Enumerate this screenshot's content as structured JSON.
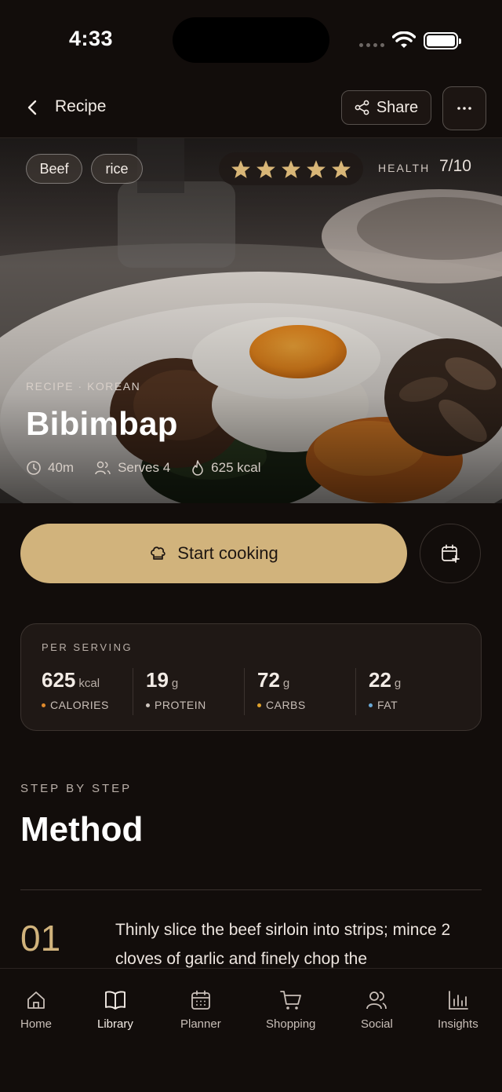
{
  "status_bar": {
    "time": "4:33"
  },
  "header": {
    "title": "Recipe",
    "share_label": "Share",
    "more_label": "···"
  },
  "hero": {
    "tags": [
      "Beef",
      "rice"
    ],
    "rating_stars": 5,
    "health_label": "HEALTH",
    "health_value": "7/10",
    "kicker": "RECIPE · KOREAN",
    "title": "Bibimbap",
    "time": "40m",
    "serves": "Serves 4",
    "calories": "625 kcal"
  },
  "actions": {
    "start_cooking": "Start cooking"
  },
  "nutrition": {
    "heading": "PER SERVING",
    "items": [
      {
        "value": "625",
        "unit": "kcal",
        "label": "CALORIES",
        "color": "#e08a2c"
      },
      {
        "value": "19",
        "unit": "g",
        "label": "PROTEIN",
        "color": "#cfc6bf"
      },
      {
        "value": "72",
        "unit": "g",
        "label": "CARBS",
        "color": "#e0a22c"
      },
      {
        "value": "22",
        "unit": "g",
        "label": "FAT",
        "color": "#6aa9d6"
      }
    ]
  },
  "method": {
    "kicker": "STEP BY STEP",
    "title": "Method",
    "steps": [
      {
        "number": "01",
        "text": "Thinly slice the beef sirloin into strips; mince 2 cloves of garlic and finely chop the"
      }
    ]
  },
  "tabbar": {
    "items": [
      {
        "label": "Home",
        "icon": "home-icon"
      },
      {
        "label": "Library",
        "icon": "book-icon"
      },
      {
        "label": "Planner",
        "icon": "calendar-icon"
      },
      {
        "label": "Shopping",
        "icon": "cart-icon"
      },
      {
        "label": "Social",
        "icon": "users-icon"
      },
      {
        "label": "Insights",
        "icon": "chart-icon"
      }
    ],
    "active": "Library"
  },
  "colors": {
    "accent": "#d1b37c",
    "background": "#120d0b",
    "card": "#1f1815"
  }
}
